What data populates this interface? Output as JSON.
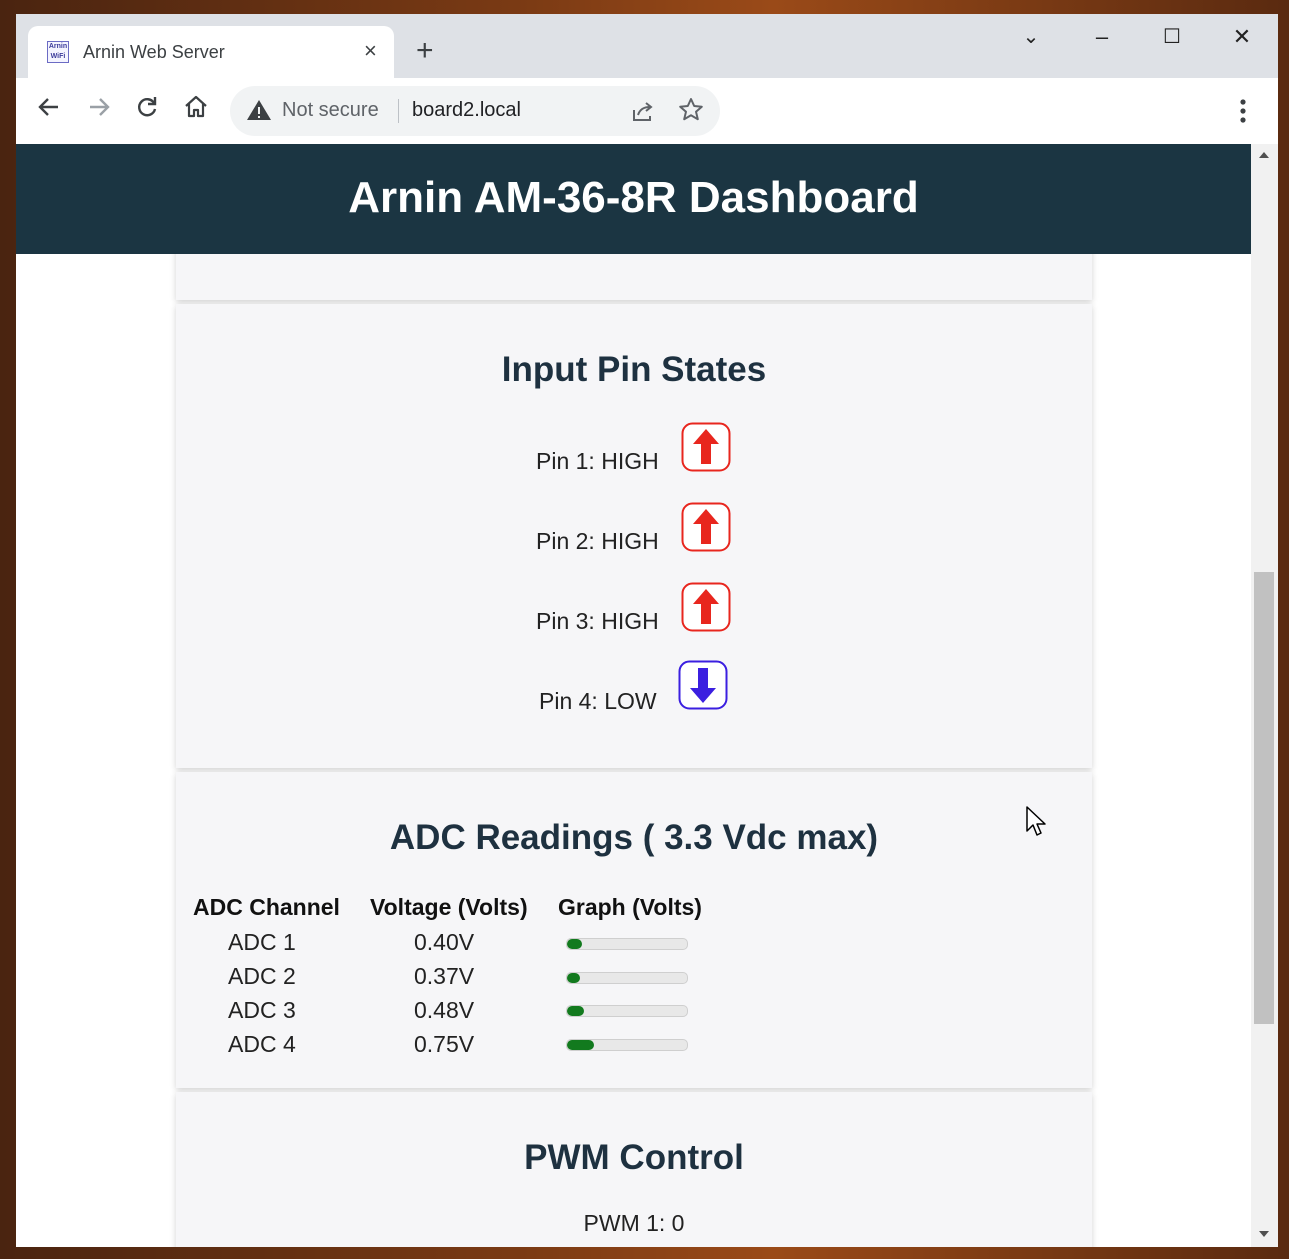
{
  "browser": {
    "tab_title": "Arnin Web Server",
    "favicon_text": "Arnin WiFi",
    "tab_close": "×",
    "new_tab": "+",
    "window_buttons": [
      "⌄",
      "–",
      "☐",
      "✕"
    ],
    "security_label": "Not secure",
    "url": "board2.local"
  },
  "page": {
    "header_title": "Arnin AM-36-8R Dashboard",
    "inputs": {
      "title": "Input Pin States",
      "pins": [
        {
          "label": "Pin 1: HIGH",
          "state": "HIGH",
          "icon": "arrow-up-icon",
          "color": "#e8261e"
        },
        {
          "label": "Pin 2: HIGH",
          "state": "HIGH",
          "icon": "arrow-up-icon",
          "color": "#e8261e"
        },
        {
          "label": "Pin 3: HIGH",
          "state": "HIGH",
          "icon": "arrow-up-icon",
          "color": "#e8261e"
        },
        {
          "label": "Pin 4: LOW",
          "state": "LOW",
          "icon": "arrow-down-icon",
          "color": "#3b1fe0"
        }
      ]
    },
    "adc": {
      "title": "ADC Readings ( 3.3 Vdc max)",
      "headers": [
        "ADC Channel",
        "Voltage (Volts)",
        "Graph (Volts)"
      ],
      "max_volts": 3.3,
      "bar_color": "#127a1e",
      "rows": [
        {
          "channel": "ADC 1",
          "voltage": "0.40V",
          "value": 0.4
        },
        {
          "channel": "ADC 2",
          "voltage": "0.37V",
          "value": 0.37
        },
        {
          "channel": "ADC 3",
          "voltage": "0.48V",
          "value": 0.48
        },
        {
          "channel": "ADC 4",
          "voltage": "0.75V",
          "value": 0.75
        }
      ]
    },
    "pwm": {
      "title": "PWM Control",
      "items": [
        {
          "label": "PWM 1: 0"
        }
      ]
    }
  },
  "colors": {
    "header_bg": "#1b3542",
    "card_bg": "#f6f6f8"
  }
}
